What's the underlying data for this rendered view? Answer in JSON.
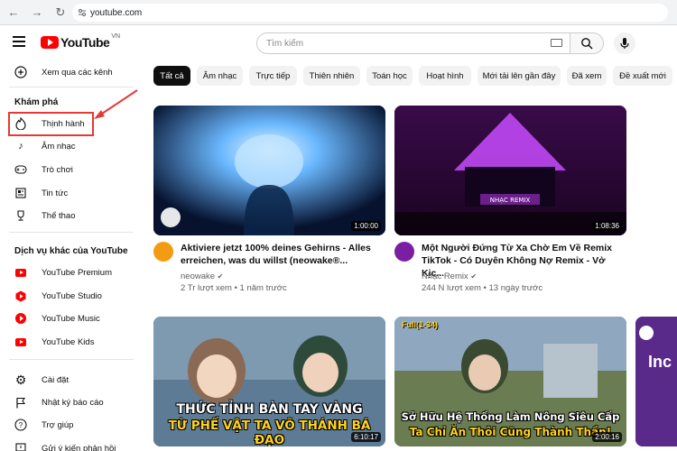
{
  "browser": {
    "url": "youtube.com"
  },
  "header": {
    "logo_text": "YouTube",
    "country_code": "VN",
    "search_placeholder": "Tìm kiếm"
  },
  "sidebar": {
    "subscriptions_item": "Xem qua các kênh",
    "explore_title": "Khám phá",
    "explore_items": [
      "Thịnh hành",
      "Âm nhạc",
      "Trò chơi",
      "Tin tức",
      "Thể thao"
    ],
    "more_title": "Dịch vụ khác của YouTube",
    "more_items": [
      "YouTube Premium",
      "YouTube Studio",
      "YouTube Music",
      "YouTube Kids"
    ],
    "settings_items": [
      "Cài đặt",
      "Nhật ký báo cáo",
      "Trợ giúp",
      "Gửi ý kiến phản hồi"
    ]
  },
  "chips": [
    "Tất cả",
    "Âm nhạc",
    "Trực tiếp",
    "Thiên nhiên",
    "Toán học",
    "Hoạt hình",
    "Mới tải lên gần đây",
    "Đã xem",
    "Đề xuất mới"
  ],
  "videos": [
    {
      "title_line1": "Aktiviere jetzt 100% deines Gehirns - Alles",
      "title_line2": "erreichen, was du willst (neowake®...",
      "channel": "neowake",
      "verified": "✔",
      "meta": "2 Tr lượt xem • 1 năm trước",
      "duration": "1:00:00",
      "avatar_color": "#f39c12"
    },
    {
      "title_line1": "Một Người Đứng Từ Xa Chờ Em Về Remix",
      "title_line2": "TikTok - Có Duyên Không Nợ Remix - Vở Kịc...",
      "channel": "Nhạc Remix",
      "verified": "✔",
      "meta": "244 N lượt xem • 13 ngày trước",
      "duration": "1:08:36",
      "avatar_color": "#7b1fa2",
      "thumb_label": "NHẠC REMIX"
    },
    {
      "duration": "6:10:17",
      "caption_line1": "THỨC TỈNH BÀN TAY VÀNG",
      "caption_line2": "TỪ PHẾ VẬT TA VÕ THÁNH BÁ ĐẠO"
    },
    {
      "duration": "2:00:16",
      "badge": "Full(1-34)",
      "caption_line1": "Sở Hữu Hệ Thống Làm Nông Siêu Cấp",
      "caption_line2": "Ta Chỉ Ăn Thôi Cũng Thành Thần!"
    },
    {
      "caption": "Inc"
    }
  ],
  "colors": {
    "accent": "#ff0000",
    "annotation": "#e53935",
    "chip_active_bg": "#0f0f0f",
    "chip_bg": "#f2f2f2"
  }
}
